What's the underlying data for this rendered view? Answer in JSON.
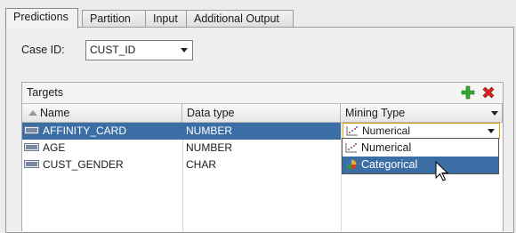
{
  "tabs": [
    {
      "label": "Predictions",
      "active": true
    },
    {
      "label": "Partition",
      "active": false
    },
    {
      "label": "Input",
      "active": false
    },
    {
      "label": "Additional Output",
      "active": false
    }
  ],
  "case_id": {
    "label": "Case ID:",
    "value": "CUST_ID"
  },
  "targets": {
    "title": "Targets",
    "add_icon": "plus-icon",
    "remove_icon": "x-icon",
    "columns": [
      "Name",
      "Data type",
      "Mining Type"
    ],
    "rows": [
      {
        "name": "AFFINITY_CARD",
        "data_type": "NUMBER",
        "mining_type": "Numerical",
        "selected": true
      },
      {
        "name": "AGE",
        "data_type": "NUMBER",
        "mining_type": ""
      },
      {
        "name": "CUST_GENDER",
        "data_type": "CHAR",
        "mining_type": ""
      }
    ]
  },
  "mining_dropdown": {
    "options": [
      "Numerical",
      "Categorical"
    ],
    "highlighted": "Categorical"
  },
  "colors": {
    "selection": "#3b6ea5",
    "add": "#2fa82f",
    "remove": "#d9251c"
  }
}
